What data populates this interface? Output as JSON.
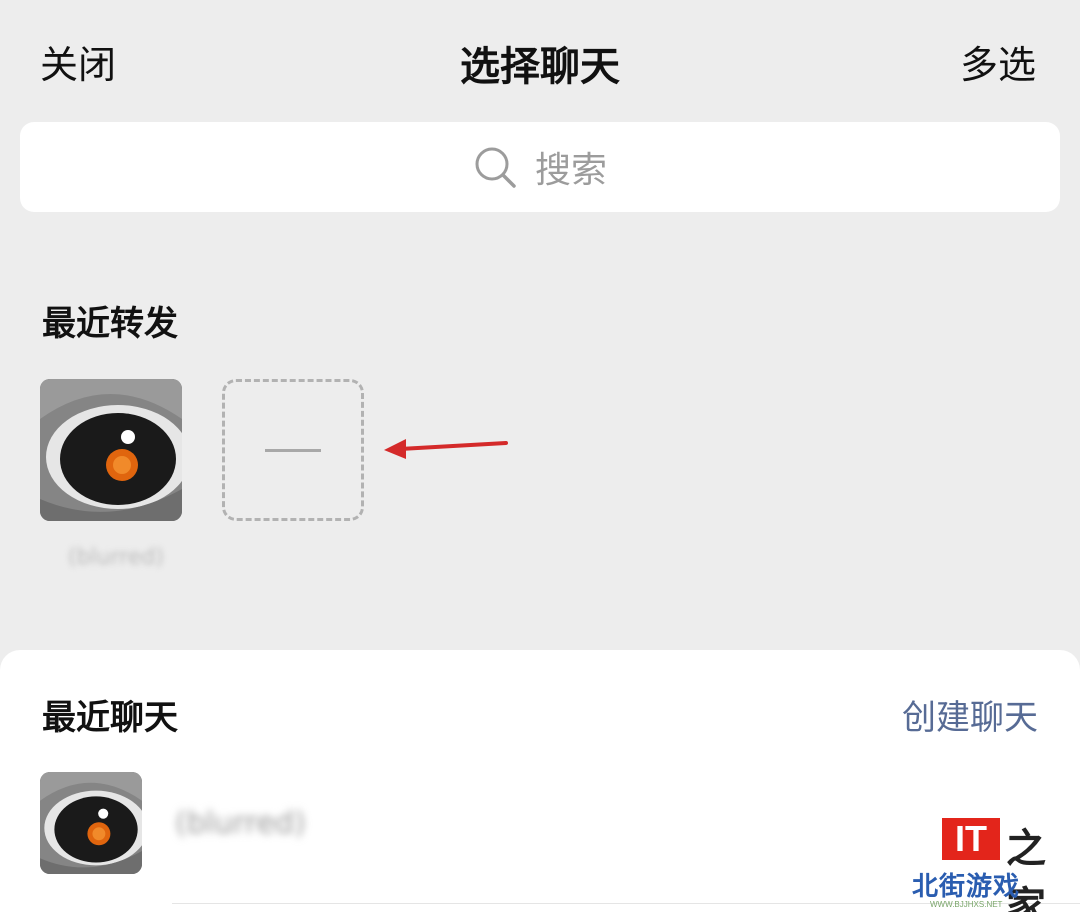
{
  "header": {
    "close_label": "关闭",
    "title": "选择聊天",
    "multi_select_label": "多选"
  },
  "search": {
    "placeholder": "搜索",
    "icon": "search-icon"
  },
  "recent_forwards": {
    "title": "最近转发",
    "items": [
      {
        "name": "(blurred)",
        "avatar": "eye-avatar"
      }
    ],
    "add_placeholder_icon": "minus-icon",
    "annotation_arrow_color": "#d42a2a"
  },
  "recent_chats": {
    "title": "最近聊天",
    "create_label": "创建聊天",
    "items": [
      {
        "name": "(blurred)",
        "avatar": "eye-avatar"
      }
    ]
  },
  "watermark": {
    "logo_text": "IT",
    "logo_suffix": "之家",
    "site_text": "北街游戏",
    "site_url": "WWW.BJJHXS.NET"
  },
  "colors": {
    "background": "#ededed",
    "link_blue": "#576b95",
    "placeholder_gray": "#9c9c9c"
  }
}
